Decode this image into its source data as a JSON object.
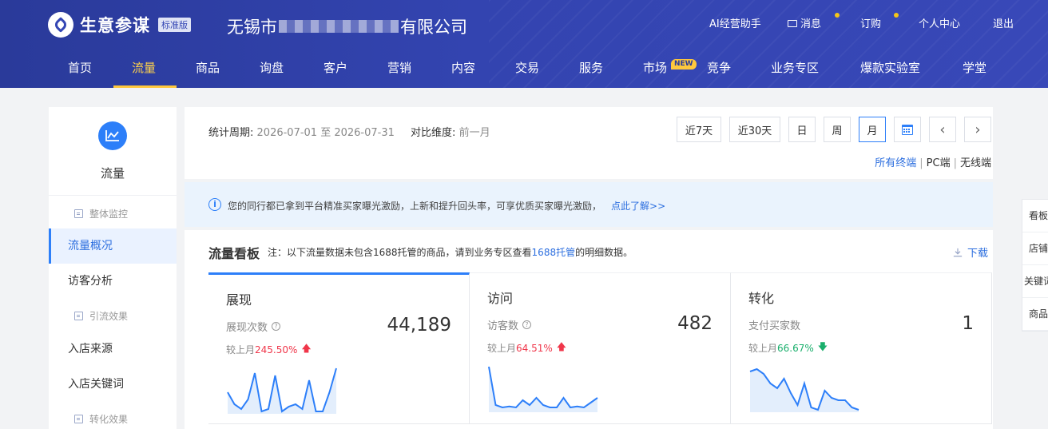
{
  "header": {
    "logo_text": "生意参谋",
    "edition_badge": "标准版",
    "company_prefix": "无锡市",
    "company_suffix": "有限公司",
    "top_links": [
      "AI经营助手",
      "消息",
      "订购",
      "个人中心",
      "退出"
    ],
    "nav": [
      "首页",
      "流量",
      "商品",
      "询盘",
      "客户",
      "营销",
      "内容",
      "交易",
      "服务",
      "市场",
      "竞争",
      "业务专区",
      "爆款实验室",
      "学堂"
    ],
    "new_badge": "NEW",
    "accent_color": "#ffc83d"
  },
  "sidebar": {
    "title": "流量",
    "group_overall": "整体监控",
    "item_overview": "流量概况",
    "item_visitor": "访客分析",
    "group_traffic": "引流效果",
    "item_source": "入店来源",
    "item_keyword": "入店关键词",
    "group_conversion": "转化效果"
  },
  "filter": {
    "period_label": "统计周期:",
    "period_value": "2026-07-01 至 2026-07-31",
    "compare_label": "对比维度:",
    "compare_value": "前一月",
    "buttons": [
      "近7天",
      "近30天",
      "日",
      "周",
      "月"
    ],
    "prev": "‹",
    "next": "›",
    "terminals": [
      "所有终端",
      "PC端",
      "无线端"
    ],
    "separator": "|"
  },
  "notice": {
    "info_glyph": "i",
    "text": "您的同行都已拿到平台精准买家曝光激励，上新和提升回头率，可享优质买家曝光激励，",
    "link": "点此了解>>"
  },
  "board": {
    "title": "流量看板",
    "note_prefix": "注：以下流量数据未包含1688托管的商品，请到业务专区查看",
    "note_link": "1688托管",
    "note_suffix": "的明细数据。",
    "download": "下载",
    "cmp_label": "较上月",
    "metrics": [
      {
        "title": "展现",
        "label": "展现次数",
        "value": "44,189",
        "change": "245.50%",
        "direction": "up",
        "arrow": "🡅",
        "has_help": true
      },
      {
        "title": "访问",
        "label": "访客数",
        "value": "482",
        "change": "64.51%",
        "direction": "up",
        "arrow": "🡅",
        "has_help": true
      },
      {
        "title": "转化",
        "label": "支付买家数",
        "value": "1",
        "change": "66.67%",
        "direction": "down",
        "arrow": "🡇",
        "has_help": false
      }
    ],
    "sparklines": [
      [
        0.55,
        0.8,
        0.9,
        0.7,
        0.15,
        0.95,
        0.9,
        0.2,
        0.95,
        0.85,
        0.8,
        0.9,
        0.3,
        0.95,
        0.95,
        0.55,
        0.05
      ],
      [
        0.05,
        0.85,
        0.9,
        0.88,
        0.9,
        0.75,
        0.85,
        0.7,
        0.85,
        0.9,
        0.9,
        0.7,
        0.9,
        0.88,
        0.9,
        0.8,
        0.7
      ],
      [
        0.15,
        0.1,
        0.2,
        0.4,
        0.5,
        0.3,
        0.6,
        0.85,
        0.4,
        0.9,
        0.95,
        0.55,
        0.7,
        0.75,
        0.75,
        0.9,
        0.95
      ]
    ],
    "colors": {
      "primary": "#2d7ff9",
      "up": "#f0364a",
      "down": "#1aaf6c"
    }
  },
  "float_tabs": [
    "看板",
    "店铺",
    "关键词",
    "商品"
  ]
}
